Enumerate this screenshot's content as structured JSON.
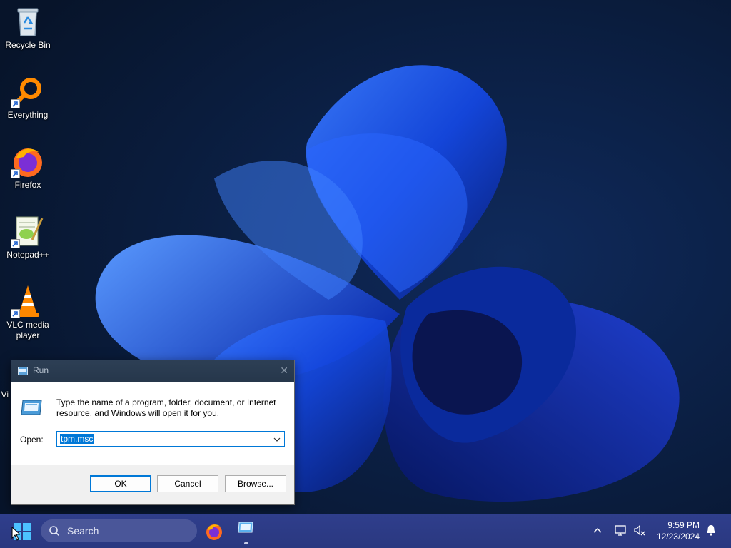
{
  "desktop": {
    "icons": [
      {
        "label": "Recycle Bin",
        "icon": "recycle-bin-icon"
      },
      {
        "label": "Everything",
        "icon": "everything-search-icon"
      },
      {
        "label": "Firefox",
        "icon": "firefox-icon"
      },
      {
        "label": "Notepad++",
        "icon": "notepad-plus-plus-icon"
      },
      {
        "label": "VLC media player",
        "icon": "vlc-cone-icon"
      },
      {
        "label": "Vi",
        "icon": "partial-icon"
      }
    ]
  },
  "run_dialog": {
    "title": "Run",
    "description": "Type the name of a program, folder, document, or Internet resource, and Windows will open it for you.",
    "open_label": "Open:",
    "open_value": "tpm.msc",
    "ok_label": "OK",
    "cancel_label": "Cancel",
    "browse_label": "Browse...",
    "close_glyph": "✕"
  },
  "taskbar": {
    "search_label": "Search",
    "clock_time": "9:59 PM",
    "clock_date": "12/23/2024",
    "accent": "#2c3b85"
  }
}
